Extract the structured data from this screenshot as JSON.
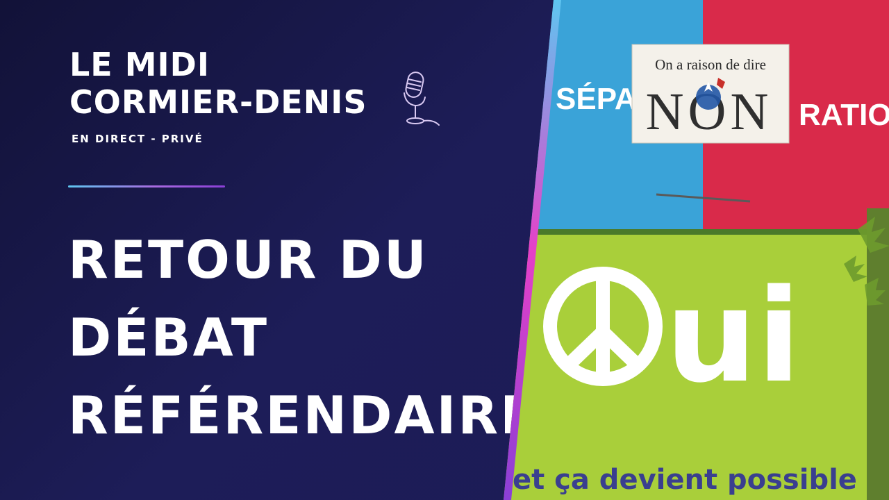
{
  "show": {
    "title_line1": "LE MIDI",
    "title_line2": "CORMIER-DENIS",
    "subtitle": "EN DIRECT - PRIVÉ"
  },
  "headline": {
    "line1": "RETOUR DU",
    "line2": "DÉBAT",
    "line3": "RÉFÉRENDAIRE"
  },
  "photo": {
    "poster_left": "SÉPA",
    "poster_right": "RATION",
    "sign_top": "On a raison de dire",
    "sign_main": "NON",
    "poster_oui": "ui",
    "poster_bottom": "et ça devient possible"
  },
  "colors": {
    "background": "#1b1b4f",
    "accent_gradient_start": "#5ec6f1",
    "accent_gradient_end": "#e640c8",
    "poster_blue": "#3aa3d8",
    "poster_red": "#d92a4a",
    "poster_green": "#a9cf3a"
  },
  "icons": [
    "microphone-icon",
    "waveform-graphic",
    "peace-sign-icon",
    "fleur-de-lis-icon"
  ]
}
